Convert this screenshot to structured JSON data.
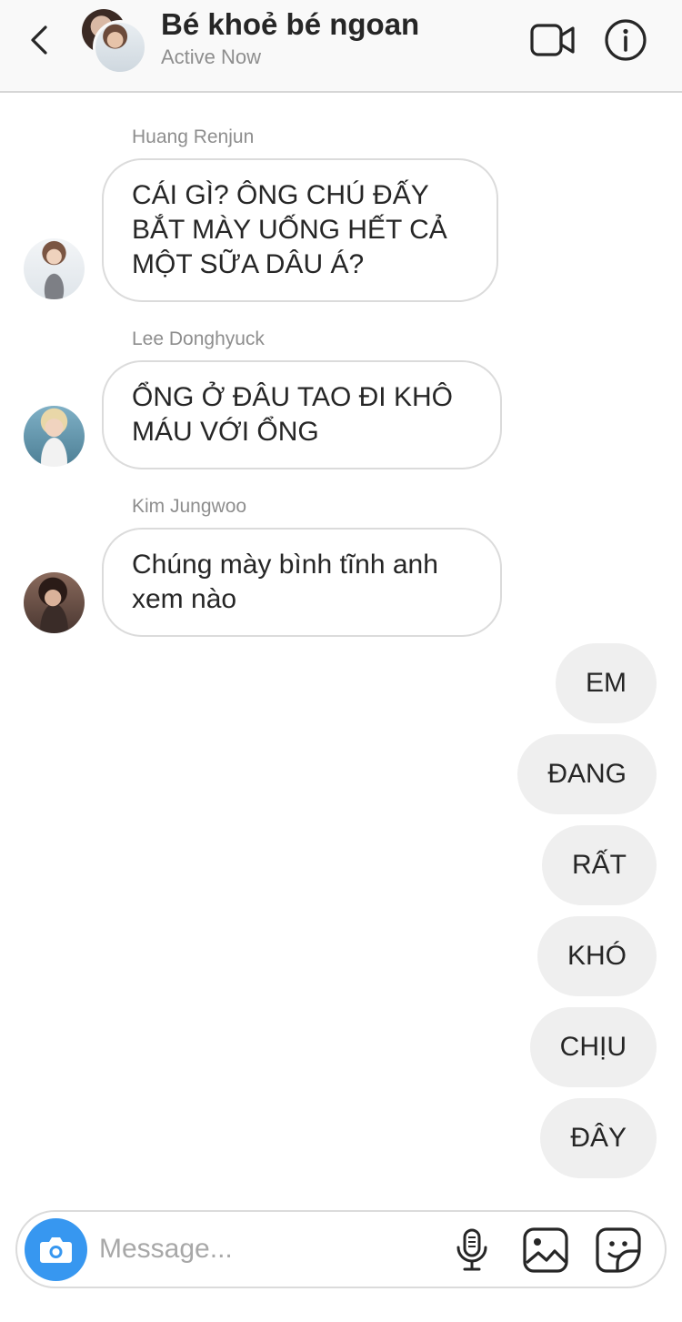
{
  "header": {
    "title": "Bé khoẻ bé ngoan",
    "status": "Active Now",
    "icons": [
      "chevron-left-icon",
      "group-avatar",
      "video-camera-icon",
      "info-icon"
    ]
  },
  "messages_in": [
    {
      "sender": "Huang Renjun",
      "text": "CÁI GÌ? ÔNG CHÚ ĐẤY BẮT MÀY UỐNG HẾT CẢ MỘT SỮA DÂU Á?"
    },
    {
      "sender": "Lee Donghyuck",
      "text": "ỔNG Ở ĐÂU TAO ĐI KHÔ MÁU VỚI ỔNG"
    },
    {
      "sender": "Kim Jungwoo",
      "text": "Chúng mày bình tĩnh anh xem nào"
    }
  ],
  "messages_out": [
    "EM",
    "ĐANG",
    "RẤT",
    "KHÓ",
    "CHỊU",
    "ĐÂY"
  ],
  "composer": {
    "placeholder": "Message...",
    "icons": [
      "camera-icon",
      "microphone-icon",
      "image-icon",
      "sticker-icon"
    ],
    "accent_color": "#3797f0"
  }
}
